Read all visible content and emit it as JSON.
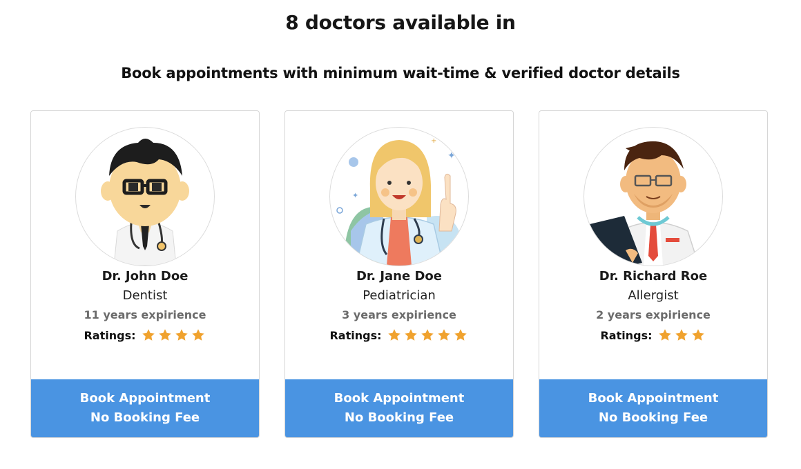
{
  "header": {
    "title": "8 doctors available in",
    "subtitle": "Book appointments with minimum wait-time & verified doctor details"
  },
  "ratings_label": "Ratings:",
  "doctors": [
    {
      "name": "Dr. John Doe",
      "specialty": "Dentist",
      "experience": "11 years expirience",
      "rating": 4,
      "avatar_icon": "male-doctor-glasses-avatar",
      "button_line1": "Book Appointment",
      "button_line2": "No Booking Fee"
    },
    {
      "name": "Dr. Jane Doe",
      "specialty": "Pediatrician",
      "experience": "3 years expirience",
      "rating": 5,
      "avatar_icon": "female-doctor-avatar",
      "button_line1": "Book Appointment",
      "button_line2": "No Booking Fee"
    },
    {
      "name": "Dr. Richard Roe",
      "specialty": "Allergist",
      "experience": "2 years expirience",
      "rating": 3,
      "avatar_icon": "male-doctor-clipboard-avatar",
      "button_line1": "Book Appointment",
      "button_line2": "No Booking Fee"
    }
  ],
  "colors": {
    "button": "#4a94e2",
    "star": "#f0a22e",
    "experience_text": "#6b6b6b"
  }
}
